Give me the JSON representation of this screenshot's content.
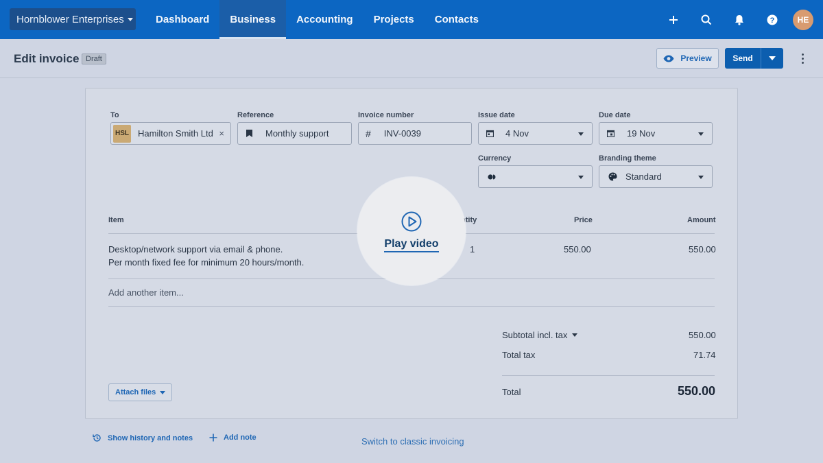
{
  "topnav": {
    "org_name": "Hornblower Enterprises",
    "items": [
      {
        "label": "Dashboard"
      },
      {
        "label": "Business"
      },
      {
        "label": "Accounting"
      },
      {
        "label": "Projects"
      },
      {
        "label": "Contacts"
      }
    ],
    "active_item": "Business",
    "icons": [
      "plus-icon",
      "search-icon",
      "bell-icon",
      "help-icon"
    ],
    "avatar_initials": "HE",
    "color": "#0c66c2"
  },
  "header": {
    "title": "Edit invoice",
    "status_badge": "Draft",
    "preview_label": "Preview",
    "send_label": "Send"
  },
  "invoice": {
    "to": {
      "label": "To",
      "contact_code": "HSL",
      "contact_name": "Hamilton Smith Ltd"
    },
    "reference": {
      "label": "Reference",
      "value": "Monthly support"
    },
    "invoice_number": {
      "label": "Invoice number",
      "value": "INV-0039"
    },
    "issue_date": {
      "label": "Issue date",
      "value": "4 Nov"
    },
    "due_date": {
      "label": "Due date",
      "value": "19 Nov"
    },
    "currency": {
      "label": "Currency",
      "value": ""
    },
    "branding_theme": {
      "label": "Branding theme",
      "value": "Standard"
    },
    "columns": {
      "item": "Item",
      "quantity": "ntity",
      "price": "Price",
      "amount": "Amount"
    },
    "line_items": [
      {
        "description_line1": "Desktop/network support via email & phone.",
        "description_line2": "Per month fixed fee for minimum 20 hours/month.",
        "quantity": "1",
        "price": "550.00",
        "amount": "550.00"
      }
    ],
    "add_item_placeholder": "Add another item...",
    "totals": {
      "subtotal_label": "Subtotal incl. tax",
      "subtotal_value": "550.00",
      "tax_label": "Total tax",
      "tax_value": "71.74",
      "total_label": "Total",
      "total_value": "550.00"
    },
    "attach_label": "Attach files"
  },
  "footer": {
    "history_label": "Show history and notes",
    "add_note_label": "Add note",
    "classic_label": "Switch to classic invoicing"
  },
  "video": {
    "label": "Play video"
  }
}
